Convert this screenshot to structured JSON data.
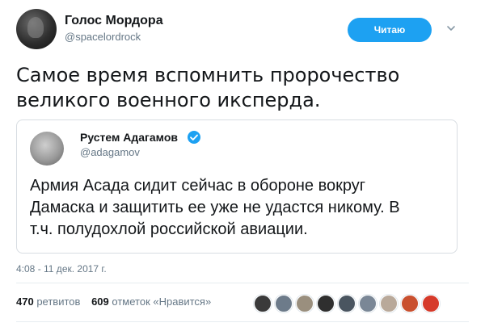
{
  "author": {
    "name": "Голос Мордора",
    "handle": "@spacelordrock"
  },
  "follow_button": {
    "label": "Читаю"
  },
  "tweet_text_lines": [
    "Самое время вспомнить пророчество",
    "великого военного иксперда."
  ],
  "quoted": {
    "name": "Рустем Адагамов",
    "handle": "@adagamov",
    "verified": true,
    "text_lines": [
      "Армия Асада сидит сейчас в обороне вокруг",
      "Дамаска и защитить ее уже не удастся никому. В",
      "т.ч. полудохлой российской авиации."
    ]
  },
  "timestamp": "4:08 - 11 дек. 2017 г.",
  "stats": {
    "retweets_count": "470",
    "retweets_label": "ретвитов",
    "likes_count": "609",
    "likes_label": "отметок «Нравится»"
  },
  "liker_avatars": [
    {
      "color": "#3a3a3a"
    },
    {
      "color": "#6d7b8a"
    },
    {
      "color": "#9a8f7e"
    },
    {
      "color": "#2f2f2f"
    },
    {
      "color": "#4a5560"
    },
    {
      "color": "#7a8796"
    },
    {
      "color": "#b9a99a"
    },
    {
      "color": "#c9502f"
    },
    {
      "color": "#d63a2a"
    }
  ],
  "colors": {
    "accent": "#1da1f2",
    "text": "#14171a",
    "secondary_text": "#657786"
  }
}
